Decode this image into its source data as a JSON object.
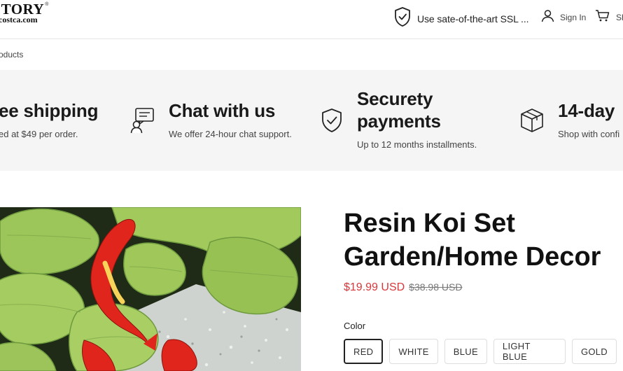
{
  "header": {
    "logo_brand": "CTORY",
    "logo_mark": "®",
    "logo_domain": "costca.com",
    "ssl_text": "Use sate-of-the-art SSL ...",
    "signin_label": "Sign In",
    "cart_label": "Sh"
  },
  "breadcrumb": "roducts",
  "features": [
    {
      "title_line1": "ee shipping",
      "title_line2": "",
      "desc": "ed at $49 per order.",
      "icon": "shipping-icon"
    },
    {
      "title_line1": "Chat with us",
      "title_line2": "",
      "desc": "We offer 24-hour chat support.",
      "icon": "chat-support-icon"
    },
    {
      "title_line1": "Securety",
      "title_line2": "payments",
      "desc": "Up to 12 months installments.",
      "icon": "shield-check-icon"
    },
    {
      "title_line1": "14-day",
      "title_line2": "",
      "desc": "Shop with confi",
      "icon": "box-icon"
    }
  ],
  "product": {
    "title_line1": "Resin Koi Set",
    "title_line2": "Garden/Home Decor",
    "sale_price": "$19.99 USD",
    "original_price": "$38.98 USD",
    "color_label": "Color",
    "colors": [
      "RED",
      "WHITE",
      "BLUE",
      "LIGHT BLUE",
      "GOLD"
    ],
    "selected_color": "RED"
  },
  "theme": {
    "sale_color": "#d9373b",
    "strip_background": "#f5f5f5"
  }
}
